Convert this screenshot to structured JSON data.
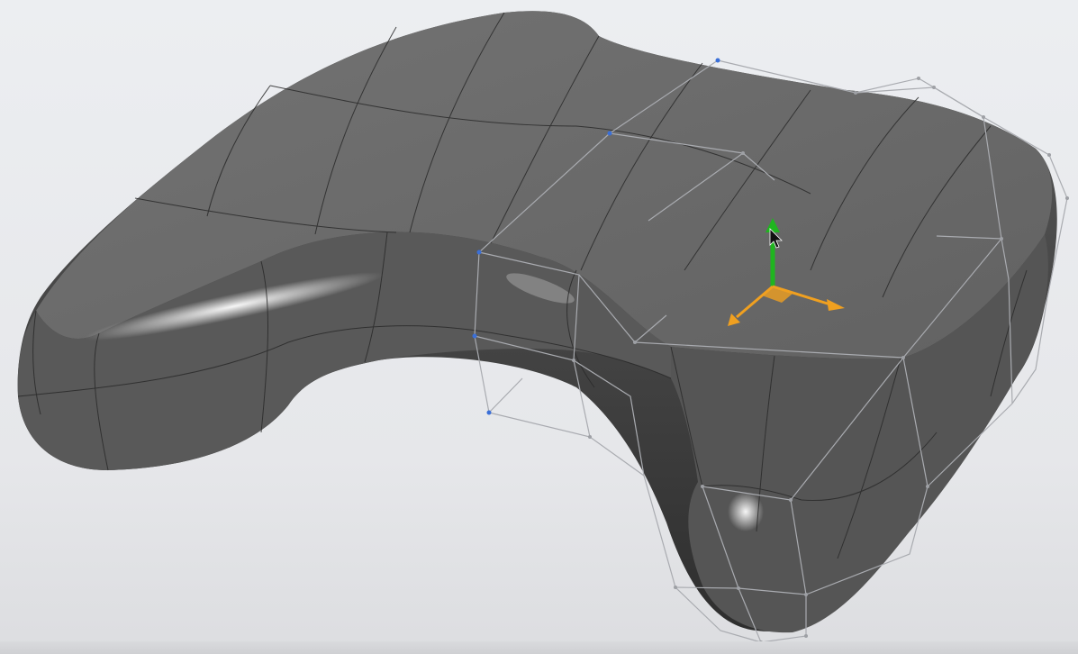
{
  "viewport": {
    "background_color": "#e8e9ec",
    "model": "game-controller",
    "surface_color": "#6b6b6b",
    "cage_color": "#a9abb0",
    "control_point_color": "#3a6fd8"
  },
  "gizmo": {
    "y_axis_color": "#1fb51f",
    "x_axis_color": "#f0a020",
    "z_axis_color": "#f0a020",
    "plane_handle_color": "#f0a020"
  },
  "cursor": "mouse-pointer-icon"
}
